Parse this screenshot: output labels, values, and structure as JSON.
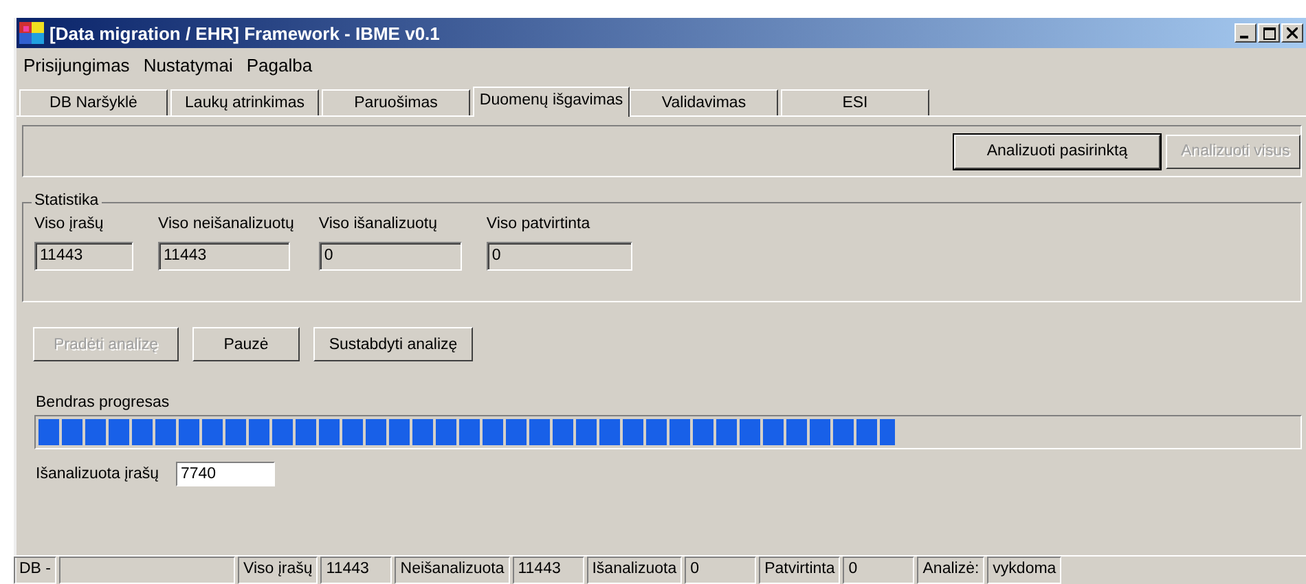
{
  "window": {
    "title": "[Data migration / EHR] Framework - IBME v0.1"
  },
  "menu": [
    "Prisijungimas",
    "Nustatymai",
    "Pagalba"
  ],
  "tabs": [
    {
      "label": "DB Naršyklė",
      "selected": false
    },
    {
      "label": "Laukų atrinkimas",
      "selected": false
    },
    {
      "label": "Paruošimas",
      "selected": false
    },
    {
      "label": "Duomenų išgavimas",
      "selected": true
    },
    {
      "label": "Validavimas",
      "selected": false
    },
    {
      "label": "ESI",
      "selected": false
    }
  ],
  "top_buttons": [
    {
      "label": "Analizuoti pasirinktą",
      "disabled": false,
      "focused": true
    },
    {
      "label": "Analizuoti visus",
      "disabled": true,
      "focused": false
    }
  ],
  "statistics": {
    "title": "Statistika",
    "fields": [
      {
        "label": "Viso įrašų",
        "value": "11443"
      },
      {
        "label": "Viso neišanalizuotų",
        "value": "11443"
      },
      {
        "label": "Viso išanalizuotų",
        "value": "0"
      },
      {
        "label": "Viso patvirtinta",
        "value": "0"
      }
    ]
  },
  "action_buttons": [
    {
      "label": "Pradėti analizę",
      "disabled": true
    },
    {
      "label": "Pauzė",
      "disabled": false
    },
    {
      "label": "Sustabdyti analizę",
      "disabled": false
    }
  ],
  "progress": {
    "label": "Bendras progresas",
    "level": 0.68
  },
  "analyzed": {
    "label": "Išanalizuota įrašų",
    "value": "7740"
  },
  "status_bar": [
    {
      "kind": "label",
      "text": "DB -"
    },
    {
      "kind": "value"
    },
    {
      "kind": "label",
      "text": "Viso įrašų"
    },
    {
      "kind": "value",
      "text": "11443"
    },
    {
      "kind": "label",
      "text": "Neišanalizuota"
    },
    {
      "kind": "value",
      "text": "11443"
    },
    {
      "kind": "label",
      "text": "Išanalizuota"
    },
    {
      "kind": "value",
      "text": "0"
    },
    {
      "kind": "label",
      "text": "Patvirtinta"
    },
    {
      "kind": "value",
      "text": "0"
    },
    {
      "kind": "label",
      "text": "Analizė:"
    },
    {
      "kind": "value",
      "text": "vykdoma"
    }
  ]
}
